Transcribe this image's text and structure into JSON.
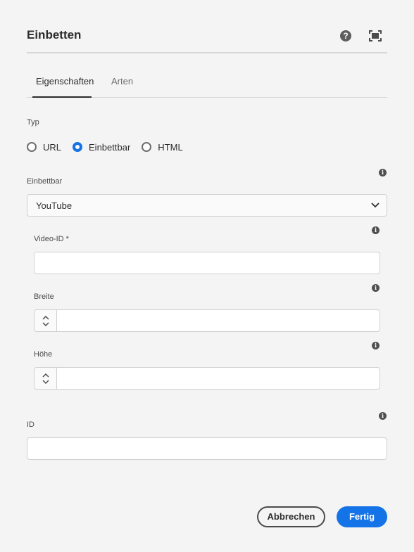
{
  "dialog": {
    "title": "Einbetten",
    "help_icon": "question-circle-icon",
    "fullscreen_icon": "fullscreen-icon"
  },
  "tabs": [
    {
      "label": "Eigenschaften",
      "selected": true
    },
    {
      "label": "Arten",
      "selected": false
    }
  ],
  "type_field": {
    "label": "Typ",
    "options": [
      {
        "label": "URL",
        "checked": false
      },
      {
        "label": "Einbettbar",
        "checked": true
      },
      {
        "label": "HTML",
        "checked": false
      }
    ]
  },
  "embeddable": {
    "label": "Einbettbar",
    "selected": "YouTube",
    "info_icon": "info-icon"
  },
  "video_id": {
    "label": "Video-ID *",
    "value": "",
    "info_icon": "info-icon"
  },
  "width": {
    "label": "Breite",
    "value": "",
    "info_icon": "info-icon"
  },
  "height": {
    "label": "Höhe",
    "value": "",
    "info_icon": "info-icon"
  },
  "id_field": {
    "label": "ID",
    "value": "",
    "info_icon": "info-icon"
  },
  "buttons": {
    "cancel": "Abbrechen",
    "done": "Fertig"
  },
  "colors": {
    "accent": "#1473e6",
    "background": "#f4f4f4",
    "text": "#2c2c2c"
  }
}
